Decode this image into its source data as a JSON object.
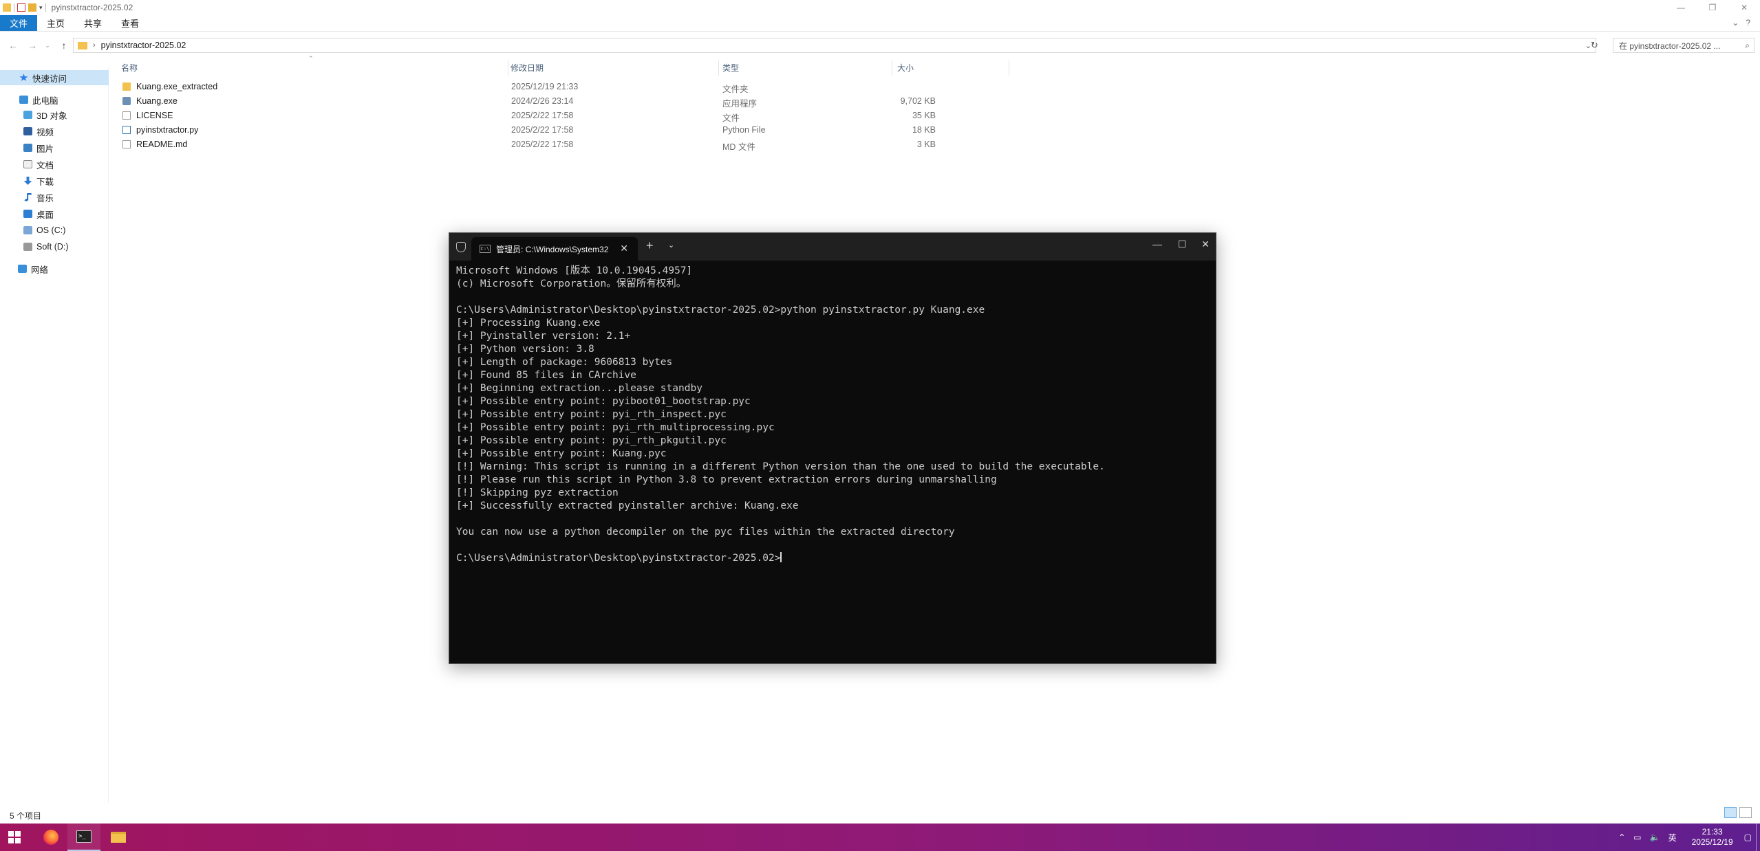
{
  "window": {
    "title": "pyinstxtractor-2025.02",
    "minimize": "—",
    "restore": "❐",
    "close": "✕"
  },
  "ribbon": {
    "tabs": [
      "文件",
      "主页",
      "共享",
      "查看"
    ],
    "expand_icon": "⌄",
    "help_icon": "?"
  },
  "address": {
    "path": "pyinstxtractor-2025.02",
    "search_placeholder": "搜索\"pyinstxtractor-2025.02\""
  },
  "search": {
    "display": "在 pyinstxtractor-2025.02 ..."
  },
  "sidebar": {
    "items": [
      {
        "label": "快速访问",
        "icon": "star-icon",
        "selected": true
      },
      {
        "label": "此电脑",
        "icon": "pc-icon"
      },
      {
        "label": "3D 对象",
        "icon": "3d-objects-icon"
      },
      {
        "label": "视频",
        "icon": "video-icon"
      },
      {
        "label": "图片",
        "icon": "pictures-icon"
      },
      {
        "label": "文档",
        "icon": "documents-icon"
      },
      {
        "label": "下载",
        "icon": "download-icon"
      },
      {
        "label": "音乐",
        "icon": "music-icon"
      },
      {
        "label": "桌面",
        "icon": "desktop-icon"
      },
      {
        "label": "OS (C:)",
        "icon": "drive-icon"
      },
      {
        "label": "Soft (D:)",
        "icon": "drive-icon"
      },
      {
        "label": "网络",
        "icon": "network-icon"
      }
    ]
  },
  "filelist": {
    "columns": {
      "name": "名称",
      "date": "修改日期",
      "type": "类型",
      "size": "大小"
    },
    "rows": [
      {
        "name": "Kuang.exe_extracted",
        "date": "2025/12/19 21:33",
        "type": "文件夹",
        "size": "",
        "icon": "folder-icon"
      },
      {
        "name": "Kuang.exe",
        "date": "2024/2/26 23:14",
        "type": "应用程序",
        "size": "9,702 KB",
        "icon": "exe-icon"
      },
      {
        "name": "LICENSE",
        "date": "2025/2/22 17:58",
        "type": "文件",
        "size": "35 KB",
        "icon": "file-icon"
      },
      {
        "name": "pyinstxtractor.py",
        "date": "2025/2/22 17:58",
        "type": "Python File",
        "size": "18 KB",
        "icon": "python-file-icon"
      },
      {
        "name": "README.md",
        "date": "2025/2/22 17:58",
        "type": "MD 文件",
        "size": "3 KB",
        "icon": "markdown-file-icon"
      }
    ]
  },
  "statusbar": {
    "count": "5 个项目"
  },
  "terminal": {
    "tab_title": "管理员: C:\\Windows\\System32",
    "tab_icon_text": "C:\\",
    "lines": [
      "Microsoft Windows [版本 10.0.19045.4957]",
      "(c) Microsoft Corporation。保留所有权利。",
      "",
      "C:\\Users\\Administrator\\Desktop\\pyinstxtractor-2025.02>python pyinstxtractor.py Kuang.exe",
      "[+] Processing Kuang.exe",
      "[+] Pyinstaller version: 2.1+",
      "[+] Python version: 3.8",
      "[+] Length of package: 9606813 bytes",
      "[+] Found 85 files in CArchive",
      "[+] Beginning extraction...please standby",
      "[+] Possible entry point: pyiboot01_bootstrap.pyc",
      "[+] Possible entry point: pyi_rth_inspect.pyc",
      "[+] Possible entry point: pyi_rth_multiprocessing.pyc",
      "[+] Possible entry point: pyi_rth_pkgutil.pyc",
      "[+] Possible entry point: Kuang.pyc",
      "[!] Warning: This script is running in a different Python version than the one used to build the executable.",
      "[!] Please run this script in Python 3.8 to prevent extraction errors during unmarshalling",
      "[!] Skipping pyz extraction",
      "[+] Successfully extracted pyinstaller archive: Kuang.exe",
      "",
      "You can now use a python decompiler on the pyc files within the extracted directory",
      ""
    ],
    "prompt": "C:\\Users\\Administrator\\Desktop\\pyinstxtractor-2025.02>"
  },
  "taskbar": {
    "tray_ime": "英",
    "time": "21:33",
    "date": "2025/12/19"
  },
  "colors": {
    "ribbon_active": "#1979ca",
    "terminal_bg": "#0c0c0c",
    "taskbar_start": "#a1155f",
    "taskbar_end": "#5f1f8f"
  }
}
